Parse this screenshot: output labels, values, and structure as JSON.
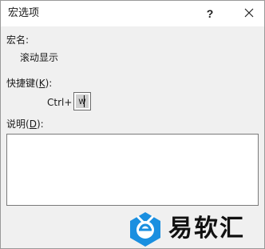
{
  "window": {
    "title": "宏选项",
    "help_label": "?",
    "close_icon": "close-icon"
  },
  "macro": {
    "name_label": "宏名:",
    "name_value": "滚动显示"
  },
  "shortcut": {
    "label_prefix": "快捷键(",
    "label_key": "K",
    "label_suffix": "):",
    "modifier": "Ctrl+",
    "key_value": "w"
  },
  "description": {
    "label_prefix": "说明(",
    "label_key": "D",
    "label_suffix": "):",
    "value": ""
  },
  "watermark": {
    "text": "易软汇",
    "accent_color": "#1a8fe0"
  }
}
